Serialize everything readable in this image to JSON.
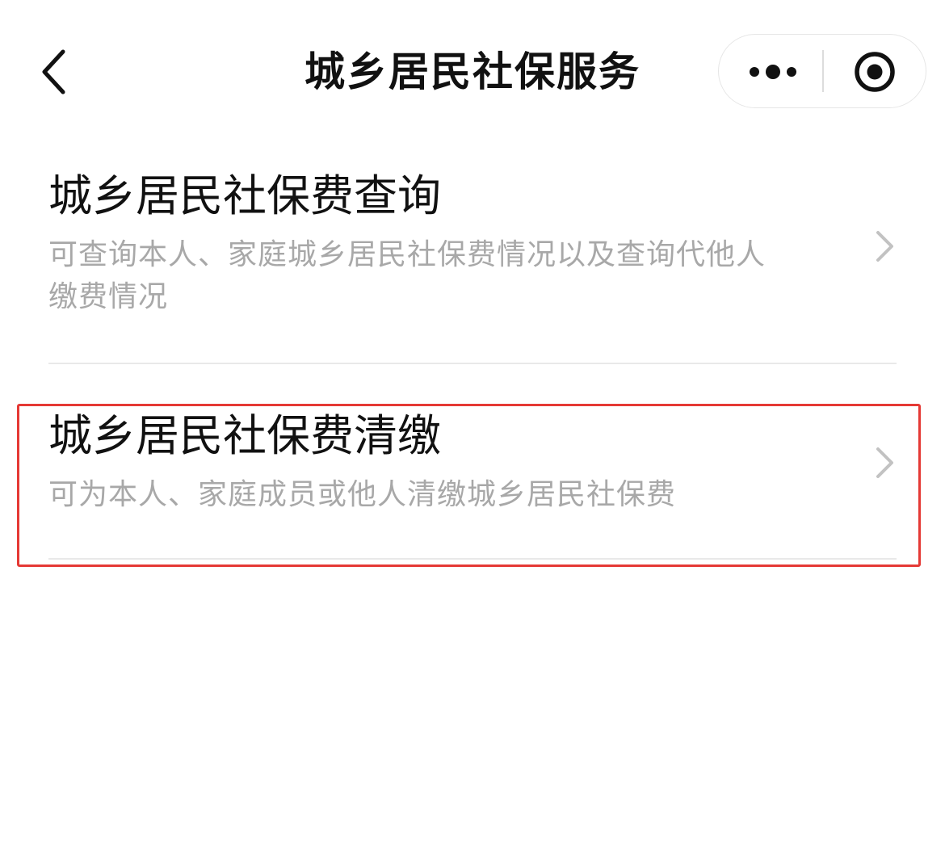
{
  "nav": {
    "title": "城乡居民社保服务",
    "back_icon": "chevron-left-icon",
    "more_icon": "more-dots-icon",
    "close_icon": "target-circle-icon"
  },
  "items": [
    {
      "title": "城乡居民社保费查询",
      "description": "可查询本人、家庭城乡居民社保费情况以及查询代他人缴费情况",
      "icon": "chevron-right-icon"
    },
    {
      "title": "城乡居民社保费清缴",
      "description": "可为本人、家庭成员或他人清缴城乡居民社保费",
      "icon": "chevron-right-icon",
      "highlighted": true
    }
  ],
  "colors": {
    "title_text": "#111111",
    "description_text": "#a8a8a8",
    "divider": "#e9e9e9",
    "highlight_border": "#e53935"
  }
}
